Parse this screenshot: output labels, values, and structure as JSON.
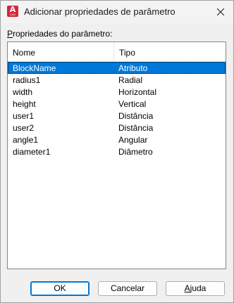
{
  "window": {
    "title": "Adicionar propriedades de parâmetro",
    "app_icon": {
      "name": "autocad-icon",
      "glyph": "A",
      "subtext": "CAD",
      "color": "#d1283b"
    },
    "close_icon": "close-icon"
  },
  "group": {
    "label_first": "P",
    "label_rest": "ropriedades do parâmetro:"
  },
  "table": {
    "columns": [
      "Nome",
      "Tipo"
    ],
    "rows": [
      {
        "nome": "BlockName",
        "tipo": "Atributo",
        "selected": true
      },
      {
        "nome": "radius1",
        "tipo": "Radial",
        "selected": false
      },
      {
        "nome": "width",
        "tipo": "Horizontal",
        "selected": false
      },
      {
        "nome": "height",
        "tipo": "Vertical",
        "selected": false
      },
      {
        "nome": "user1",
        "tipo": "Distância",
        "selected": false
      },
      {
        "nome": "user2",
        "tipo": "Distância",
        "selected": false
      },
      {
        "nome": "angle1",
        "tipo": "Angular",
        "selected": false
      },
      {
        "nome": "diameter1",
        "tipo": "Diâmetro",
        "selected": false
      }
    ],
    "selection_color": "#0078d7"
  },
  "buttons": {
    "ok": "OK",
    "cancel": "Cancelar",
    "help_first": "A",
    "help_rest": "juda"
  }
}
